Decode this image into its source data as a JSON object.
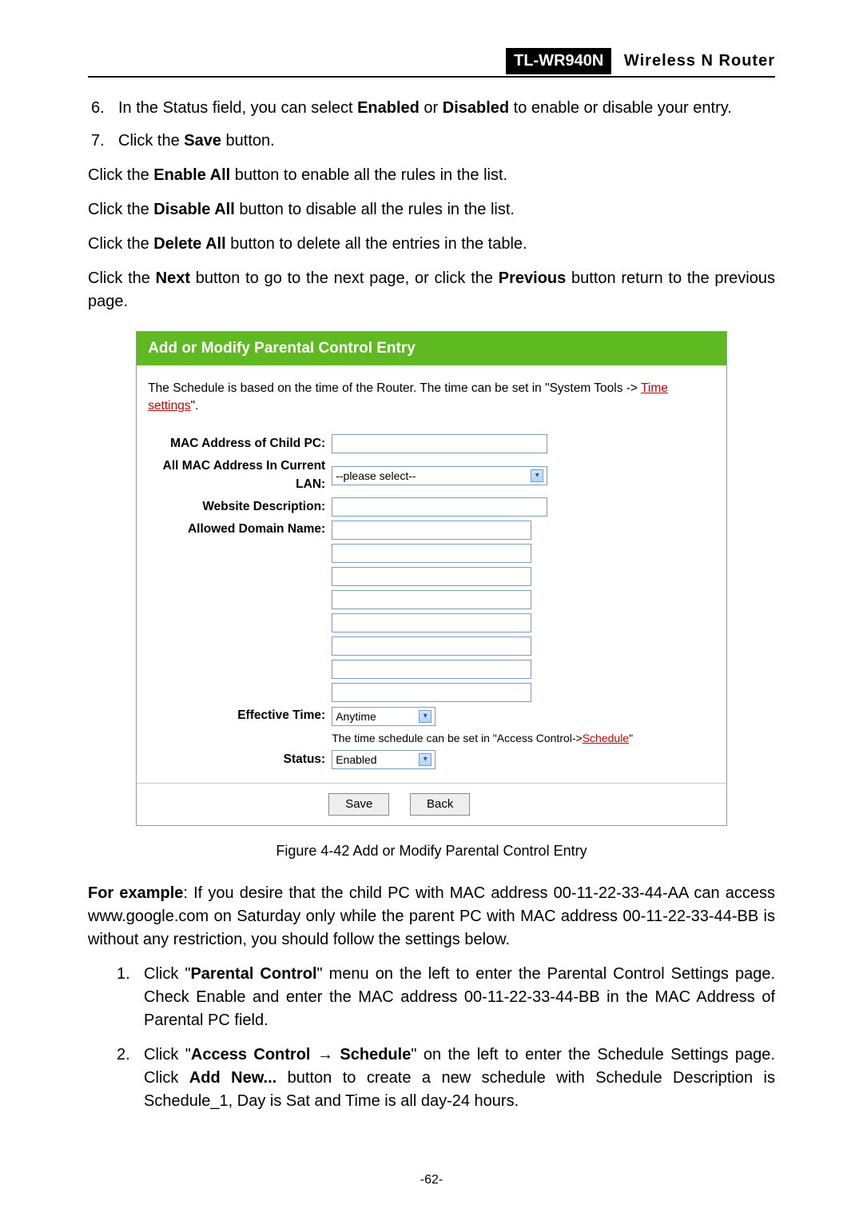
{
  "header": {
    "model": "TL-WR940N",
    "title": "Wireless  N  Router"
  },
  "steps": {
    "s6": {
      "num": "6.",
      "prefix": "In the Status field, you can select ",
      "enabled": "Enabled",
      "mid": " or ",
      "disabled": "Disabled",
      "suffix": " to enable or disable your entry."
    },
    "s7": {
      "num": "7.",
      "prefix": "Click the ",
      "save": "Save",
      "suffix": " button."
    }
  },
  "paras": {
    "enable": {
      "a": "Click the ",
      "b": "Enable All",
      "c": " button to enable all the rules in the list."
    },
    "disable": {
      "a": "Click the ",
      "b": "Disable All",
      "c": " button to disable all the rules in the list."
    },
    "delete": {
      "a": "Click the ",
      "b": "Delete All",
      "c": " button to delete all the entries in the table."
    },
    "nav": {
      "a": "Click the ",
      "b": "Next",
      "c": " button to go to the next page, or click the ",
      "d": "Previous",
      "e": " button return to the previous page."
    }
  },
  "panel": {
    "title": "Add or Modify Parental Control Entry",
    "note_prefix": "The Schedule is based on the time of the Router. The time can be set in \"System Tools -> ",
    "note_link": "Time settings",
    "note_suffix": "\".",
    "labels": {
      "mac": "MAC Address of Child PC:",
      "allmac": "All MAC Address In Current LAN:",
      "webdesc": "Website Description:",
      "domain": "Allowed Domain Name:",
      "efftime": "Effective Time:",
      "status": "Status:"
    },
    "select_placeholder": "--please select--",
    "efftime_value": "Anytime",
    "efftime_helper_a": "The time schedule can be set in \"Access Control->",
    "efftime_helper_link": "Schedule",
    "efftime_helper_b": "\"",
    "status_value": "Enabled",
    "buttons": {
      "save": "Save",
      "back": "Back"
    }
  },
  "fig_caption": "Figure 4-42    Add or Modify Parental Control Entry",
  "example": {
    "lead": "For example",
    "body": ": If you desire that the child PC with MAC address 00-11-22-33-44-AA can access www.google.com on Saturday only while the parent PC with MAC address 00-11-22-33-44-BB is without any restriction, you should follow the settings below."
  },
  "exsteps": {
    "e1": {
      "num": "1.",
      "a": "Click \"",
      "b": "Parental Control",
      "c": "\" menu on the left to enter the Parental Control Settings page. Check Enable and enter the MAC address 00-11-22-33-44-BB in the MAC Address of Parental PC field."
    },
    "e2": {
      "num": "2.",
      "a": "Click \"",
      "b": "Access Control → Schedule",
      "c": "\" on the left to enter the Schedule Settings page. Click ",
      "d": "Add New...",
      "e": " button to create a new schedule with Schedule Description is Schedule_1, Day is Sat and Time is all day-24 hours."
    }
  },
  "page_number": "-62-"
}
